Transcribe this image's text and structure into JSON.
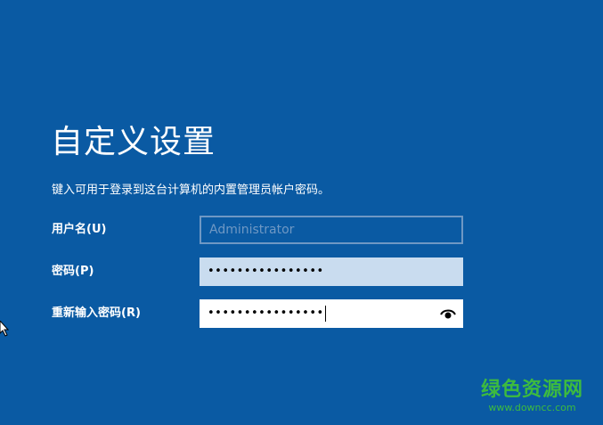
{
  "page": {
    "title": "自定义设置",
    "subtitle": "键入可用于登录到这台计算机的内置管理员帐户密码。"
  },
  "form": {
    "username_label": "用户名(U)",
    "username_value": "Administrator",
    "password_label": "密码(P)",
    "password_value": "••••••••••••••••",
    "reenter_label": "重新输入密码(R)",
    "reenter_value": "••••••••••••••••"
  },
  "icons": {
    "reveal": "eye-icon",
    "pointer": "mouse-pointer-icon"
  },
  "colors": {
    "background": "#0a5aa3",
    "watermark": "#3dbb3f"
  },
  "watermark": {
    "name": "绿色资源网",
    "url": "www.downcc.com"
  }
}
